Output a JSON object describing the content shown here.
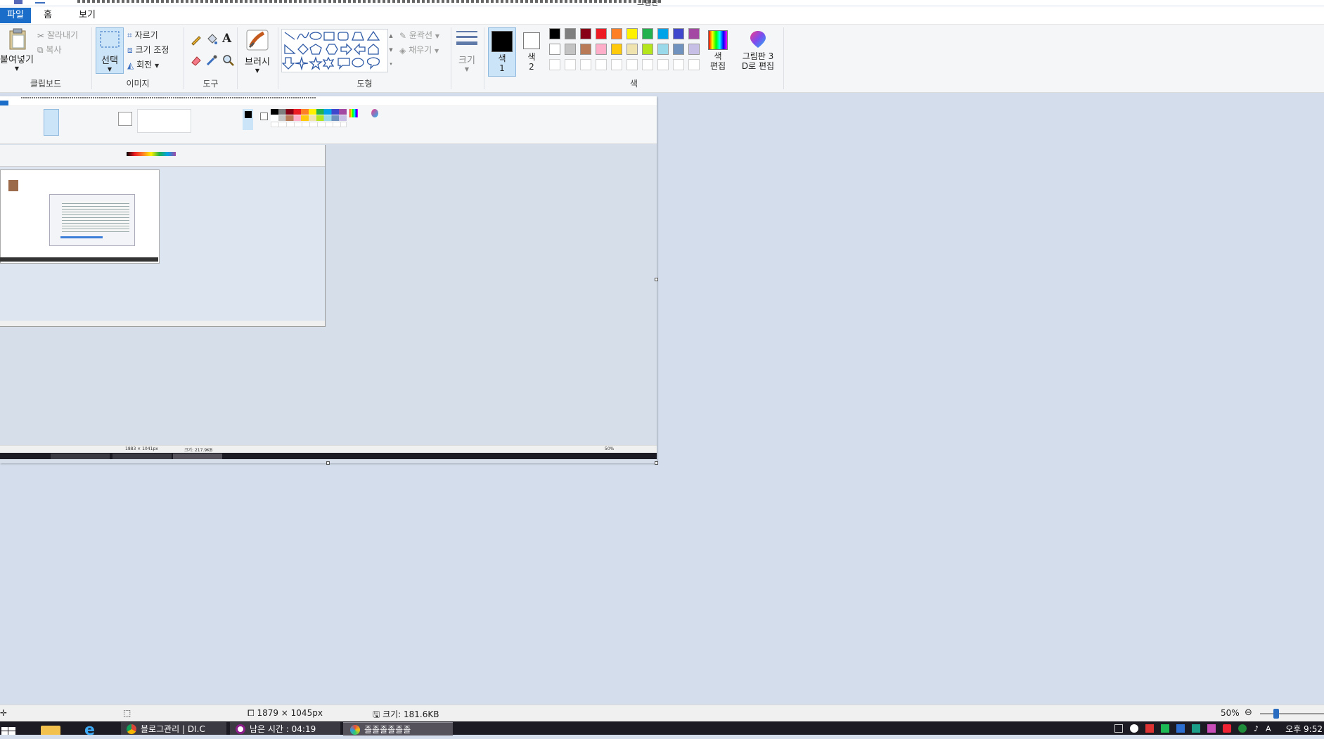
{
  "window": {
    "title": "그림판"
  },
  "menu": {
    "file": "파일",
    "home": "홈",
    "view": "보기"
  },
  "ribbon": {
    "clipboard": {
      "paste": "붙여넣기",
      "cut": "잘라내기",
      "copy": "복사",
      "label": "클립보드"
    },
    "image": {
      "select": "선택",
      "crop": "자르기",
      "resize": "크기 조정",
      "rotate": "회전",
      "label": "이미지"
    },
    "tools": {
      "label": "도구"
    },
    "brushes": {
      "label": "브러시"
    },
    "shapes": {
      "outline": "윤곽선",
      "fill": "채우기",
      "label": "도형"
    },
    "size": {
      "label": "크기"
    },
    "colors": {
      "color1": "색\n1",
      "color2": "색\n2",
      "edit_colors": "색\n편집",
      "paint3d": "그림판 3\nD로 편집",
      "label": "색",
      "palette_row1": [
        "#000000",
        "#7f7f7f",
        "#880015",
        "#ed1c24",
        "#ff7f27",
        "#fff200",
        "#22b14c",
        "#00a2e8",
        "#3f48cc",
        "#a349a4"
      ],
      "palette_row2": [
        "#ffffff",
        "#c3c3c3",
        "#b97a57",
        "#ffaec9",
        "#ffc90e",
        "#efe4b0",
        "#b5e61d",
        "#99d9ea",
        "#7092be",
        "#c8bfe7"
      ]
    }
  },
  "status": {
    "dimensions": "1879 × 1045px",
    "file_size": "크기: 181.6KB",
    "zoom": "50%"
  },
  "taskbar": {
    "items": [
      "블로그관리 | DI.C",
      "남은 시간 : 04:19",
      "졸졸졸졸졸졸"
    ],
    "clock": "오후 9:52"
  },
  "nested": {
    "dimensions": "1883 × 1041px",
    "file_size": "크기: 217.9KB",
    "zoom": "50%"
  }
}
